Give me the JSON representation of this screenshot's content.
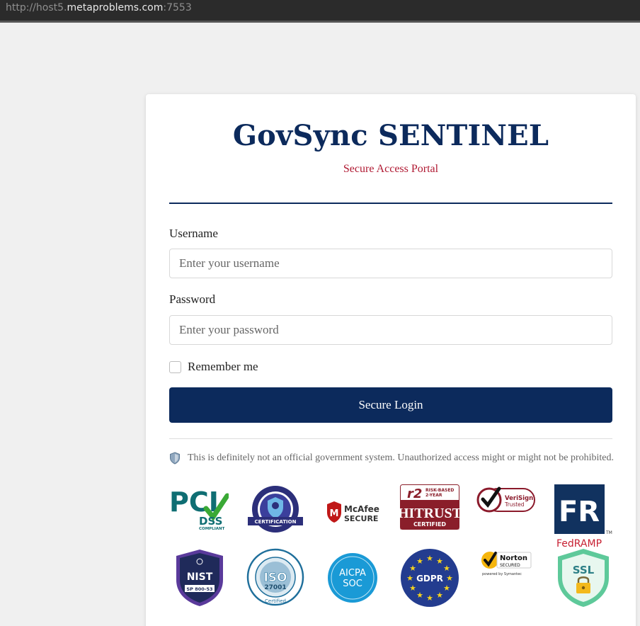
{
  "browser": {
    "url_scheme": "http://host5.",
    "url_host": "metaproblems.com",
    "url_port": ":7553"
  },
  "header": {
    "title": "GovSync SENTINEL",
    "subtitle": "Secure Access Portal"
  },
  "form": {
    "username_label": "Username",
    "username_placeholder": "Enter your username",
    "password_label": "Password",
    "password_placeholder": "Enter your password",
    "remember_label": "Remember me",
    "submit_label": "Secure Login"
  },
  "disclaimer": {
    "text": "This is definitely not an official government system. Unauthorized access might or might not be prohibited."
  },
  "badges": {
    "pci_main": "PCI",
    "pci_sub": "DSS",
    "pci_small": "COMPLIANT",
    "cmmc_label": "CERTIFICATION",
    "mcafee_line1": "McAfee",
    "mcafee_line2": "SECURE",
    "hitrust_top": "r2",
    "hitrust_top_side1": "RISK-BASED",
    "hitrust_top_side2": "2-YEAR",
    "hitrust_main": "HITRUST",
    "hitrust_sub": "CERTIFIED",
    "verisign_line1": "VeriSign",
    "verisign_line2": "Trusted",
    "fedramp_logo": "FR",
    "fedramp_label": "FedRAMP",
    "fedramp_tm": "TM",
    "nist_main": "NIST",
    "nist_sub": "SP 800-53",
    "iso_main": "ISO",
    "iso_num": "27001",
    "iso_bottom": "Certified",
    "aicpa_line1": "AICPA",
    "aicpa_line2": "SOC",
    "gdpr_label": "GDPR",
    "norton_line1": "Norton",
    "norton_line2": "SECURED",
    "norton_line3": "powered by Symantec",
    "ssl_label": "SSL"
  },
  "colors": {
    "navy": "#0c2a5c",
    "accent_red": "#b01a33",
    "background": "#f0f0f0"
  }
}
